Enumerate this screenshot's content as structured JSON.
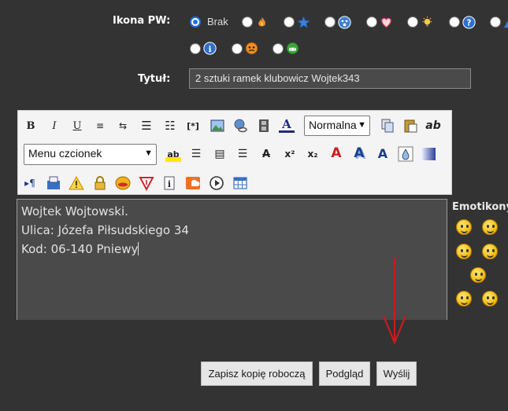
{
  "form": {
    "icon_label": "Ikona PW:",
    "icon_none": "Brak",
    "title_label": "Tytuł:",
    "title_value": "2 sztuki ramek klubowicz Wojtek343"
  },
  "toolbar": {
    "format_select": "Normalna",
    "font_select": "Menu czcionek"
  },
  "editor": {
    "lines": [
      "Wojtek Wojtowski.",
      "Ulica: Józefa Piłsudskiego 34",
      "Kod: 06-140 Pniewy"
    ]
  },
  "emoticons": {
    "title": "Emotikony"
  },
  "buttons": {
    "save_draft": "Zapisz kopię roboczą",
    "preview": "Podgląd",
    "send": "Wyślij"
  },
  "colors": {
    "background": "#333333",
    "accent": "#1a73e8",
    "annotation_arrow": "#cc1b1b"
  }
}
